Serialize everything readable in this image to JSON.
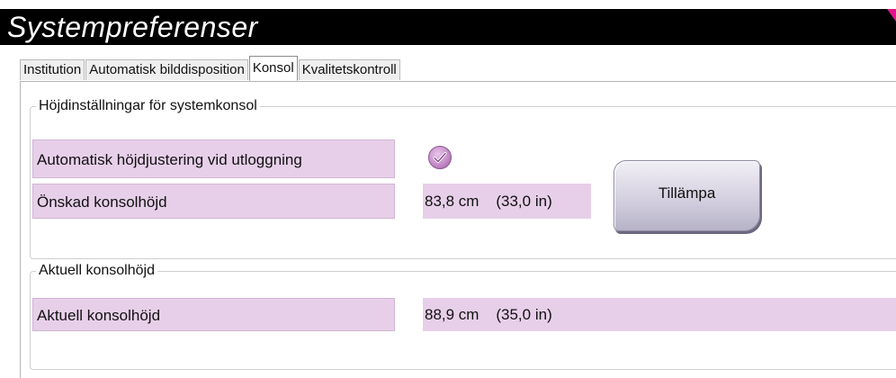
{
  "window": {
    "title": "Systempreferenser"
  },
  "tabs": [
    {
      "label": "Institution",
      "active": false
    },
    {
      "label": "Automatisk bilddisposition",
      "active": false
    },
    {
      "label": "Konsol",
      "active": true
    },
    {
      "label": "Kvalitetskontroll",
      "active": false
    }
  ],
  "height_settings": {
    "legend": "Höjdinställningar för systemkonsol",
    "auto_adjust_label": "Automatisk höjdjustering vid utloggning",
    "auto_adjust_checked": true,
    "desired_height_label": "Önskad konsolhöjd",
    "desired_height_value": "83,8 cm    (33,0 in)",
    "apply_label": "Tillämpa"
  },
  "current_height": {
    "legend": "Aktuell konsolhöjd",
    "label": "Aktuell konsolhöjd",
    "value": "88,9 cm    (35,0 in)"
  },
  "colors": {
    "field_background": "#e7cfe9",
    "titlebar": "#000000",
    "accent": "#e0148a"
  }
}
